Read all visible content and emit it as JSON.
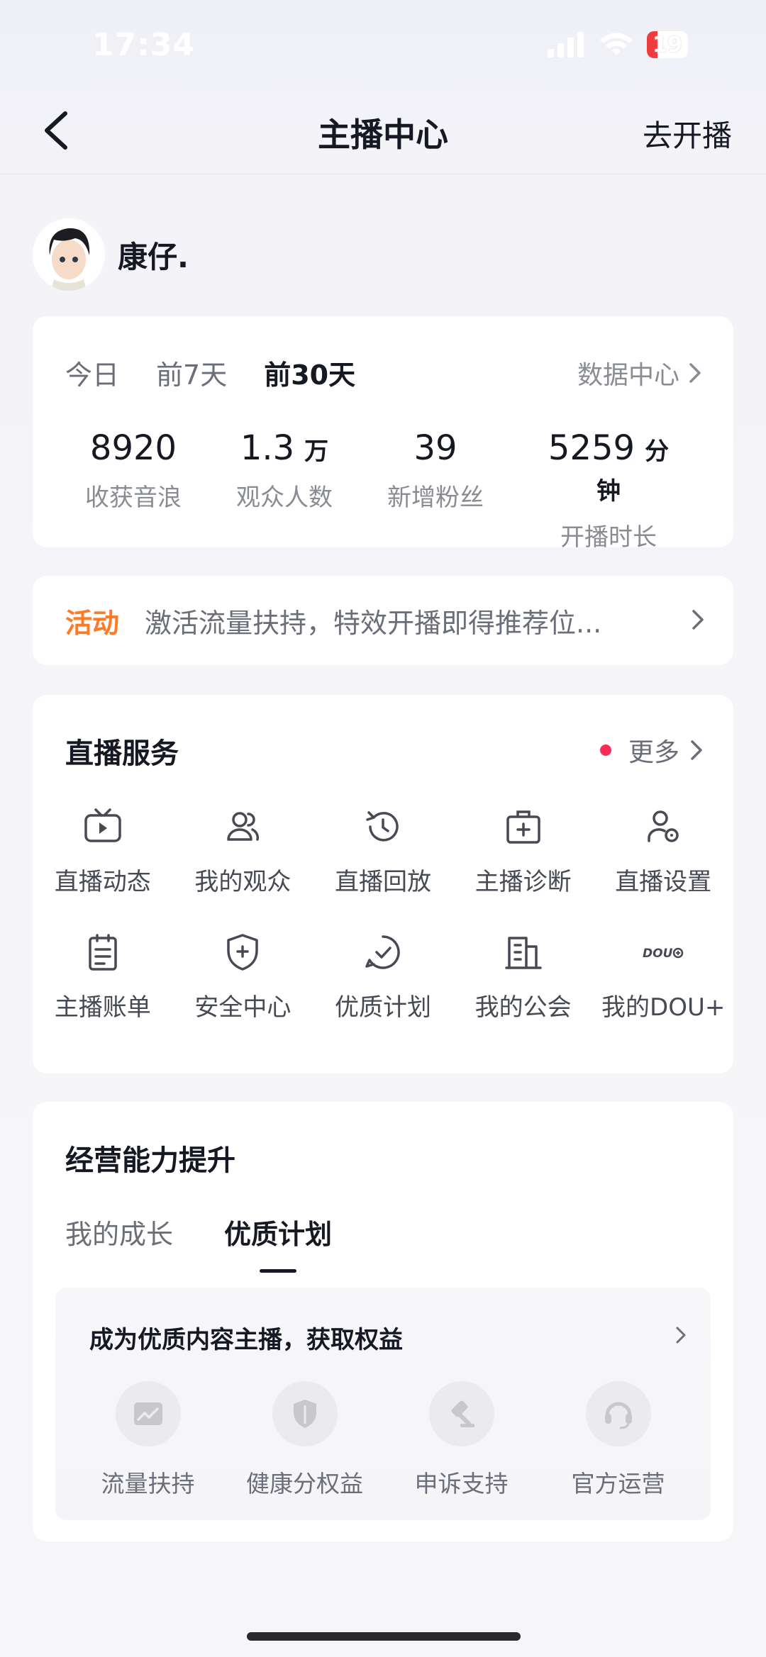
{
  "status_bar": {
    "time": "17:34",
    "battery": "19"
  },
  "nav": {
    "title": "主播中心",
    "action": "去开播"
  },
  "profile": {
    "name": "康仔."
  },
  "stats_card": {
    "tabs": [
      "今日",
      "前7天",
      "前30天"
    ],
    "active_tab": "前30天",
    "data_center": "数据中心",
    "stats": [
      {
        "value": "8920",
        "unit": "",
        "label": "收获音浪"
      },
      {
        "value": "1.3",
        "unit": "万",
        "label": "观众人数"
      },
      {
        "value": "39",
        "unit": "",
        "label": "新增粉丝"
      },
      {
        "value": "5259",
        "unit": "分钟",
        "label": "开播时长"
      }
    ]
  },
  "activity": {
    "tag": "活动",
    "text": "激活流量扶持，特效开播即得推荐位..."
  },
  "services": {
    "title": "直播服务",
    "more": "更多",
    "items": [
      {
        "label": "直播动态",
        "icon": "tv-play-icon"
      },
      {
        "label": "我的观众",
        "icon": "audience-icon"
      },
      {
        "label": "直播回放",
        "icon": "replay-clock-icon"
      },
      {
        "label": "主播诊断",
        "icon": "medical-kit-icon"
      },
      {
        "label": "直播设置",
        "icon": "user-settings-icon"
      },
      {
        "label": "主播账单",
        "icon": "bill-icon"
      },
      {
        "label": "安全中心",
        "icon": "shield-plus-icon"
      },
      {
        "label": "优质计划",
        "icon": "check-circle-icon"
      },
      {
        "label": "我的公会",
        "icon": "building-icon"
      },
      {
        "label": "我的DOU+",
        "icon": "dou-plus-icon"
      }
    ]
  },
  "growth": {
    "title": "经营能力提升",
    "tabs": [
      "我的成长",
      "优质计划"
    ],
    "active_tab": "优质计划",
    "banner_title": "成为优质内容主播，获取权益",
    "benefits": [
      {
        "label": "流量扶持",
        "icon": "traffic-chart-icon"
      },
      {
        "label": "健康分权益",
        "icon": "health-shield-icon"
      },
      {
        "label": "申诉支持",
        "icon": "gavel-icon"
      },
      {
        "label": "官方运营",
        "icon": "headset-icon"
      }
    ]
  }
}
